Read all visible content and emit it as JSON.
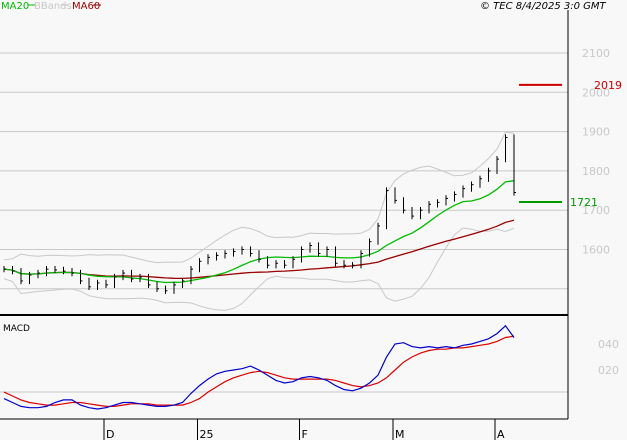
{
  "legend": {
    "ma20": "MA20",
    "bbands": "BBands",
    "ma60": "MA60"
  },
  "copyright": "© TEC 8/4/2025 3:0 GMT",
  "colors": {
    "ma20": "#00bb00",
    "bbands": "#c8c8c8",
    "ma60": "#990000",
    "macd": "#0000cc",
    "signal": "#dd0000",
    "marker_high": "#cc0000",
    "marker_last": "#009900"
  },
  "chart_data": [
    {
      "type": "line",
      "title": "Price",
      "y_ticks": [
        2100,
        2000,
        1900,
        1800,
        1700,
        1600,
        1500
      ],
      "y_tick_labels": [
        "2100",
        "2000",
        "1900",
        "1800",
        "1700",
        "1600"
      ],
      "ylim": [
        1420,
        2220
      ],
      "x_labels": [
        {
          "label": "D",
          "index": 12
        },
        {
          "label": "25",
          "index": 23
        },
        {
          "label": "F",
          "index": 35
        },
        {
          "label": "M",
          "index": 46
        },
        {
          "label": "A",
          "index": 58
        }
      ],
      "closes": [
        1550,
        1545,
        1520,
        1535,
        1540,
        1550,
        1548,
        1545,
        1540,
        1520,
        1505,
        1515,
        1510,
        1530,
        1540,
        1525,
        1530,
        1510,
        1500,
        1495,
        1510,
        1520,
        1550,
        1570,
        1580,
        1585,
        1590,
        1595,
        1600,
        1590,
        1575,
        1560,
        1565,
        1560,
        1575,
        1600,
        1610,
        1590,
        1600,
        1565,
        1560,
        1560,
        1590,
        1620,
        1660,
        1750,
        1725,
        1700,
        1685,
        1700,
        1715,
        1720,
        1730,
        1740,
        1755,
        1765,
        1780,
        1800,
        1830,
        1885,
        1745
      ],
      "markers": [
        {
          "label": "2019",
          "value": 2019,
          "kind": "high"
        },
        {
          "label": "1721",
          "value": 1721,
          "kind": "last"
        }
      ]
    },
    {
      "type": "line",
      "title": "MACD",
      "y_tick_labels": [
        "040",
        "020"
      ],
      "y_ticks": [
        40,
        20
      ],
      "ylim": [
        -18,
        62
      ],
      "macd": [
        -2,
        -5,
        -8,
        -9,
        -9,
        -8,
        -5,
        -3,
        -3,
        -7,
        -9,
        -10,
        -9,
        -7,
        -5,
        -5,
        -6,
        -7,
        -8,
        -8,
        -7,
        -5,
        2,
        8,
        13,
        17,
        19,
        20,
        21,
        23,
        20,
        16,
        12,
        10,
        11,
        14,
        15,
        14,
        12,
        8,
        5,
        4,
        6,
        10,
        16,
        30,
        40,
        41,
        38,
        37,
        38,
        37,
        38,
        37,
        39,
        40,
        42,
        44,
        48,
        54,
        45
      ],
      "signal": [
        3,
        0,
        -3,
        -5,
        -6,
        -7,
        -7,
        -6,
        -5,
        -5,
        -6,
        -7,
        -8,
        -8,
        -7,
        -6,
        -6,
        -6,
        -7,
        -7,
        -7,
        -7,
        -5,
        -2,
        3,
        7,
        11,
        14,
        16,
        18,
        19,
        18,
        16,
        14,
        13,
        13,
        13,
        13,
        13,
        12,
        10,
        8,
        7,
        8,
        10,
        14,
        20,
        26,
        30,
        33,
        35,
        36,
        36,
        37,
        37,
        38,
        39,
        40,
        42,
        45,
        46
      ]
    }
  ]
}
